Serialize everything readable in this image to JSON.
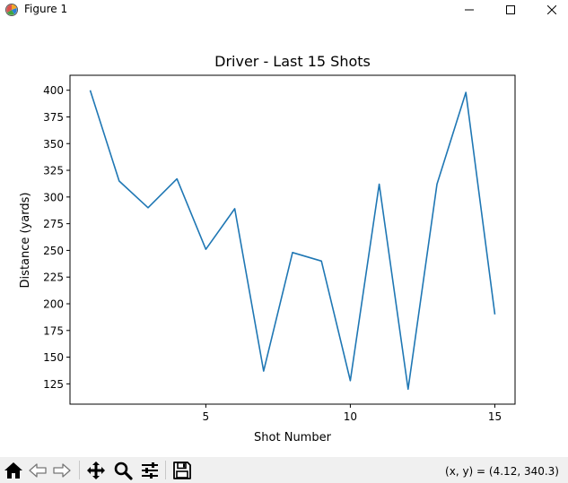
{
  "window": {
    "title": "Figure 1",
    "app_icon": "matplotlib-icon",
    "controls": {
      "minimize_icon": "minimize-icon",
      "maximize_icon": "maximize-icon",
      "close_icon": "close-icon"
    }
  },
  "toolbar": {
    "tools": [
      {
        "name": "home",
        "icon": "home-icon"
      },
      {
        "name": "back",
        "icon": "back-arrow-icon"
      },
      {
        "name": "forward",
        "icon": "forward-arrow-icon"
      },
      {
        "name": "pan",
        "icon": "pan-icon"
      },
      {
        "name": "zoom",
        "icon": "zoom-icon"
      },
      {
        "name": "configure-subplots",
        "icon": "sliders-icon"
      },
      {
        "name": "save",
        "icon": "save-icon"
      }
    ],
    "coords": "(x, y) = (4.12, 340.3)"
  },
  "colors": {
    "line": "#1f77b4",
    "toolbar_bg": "#f0f0f0"
  },
  "chart_data": {
    "type": "line",
    "title": "Driver - Last 15 Shots",
    "xlabel": "Shot Number",
    "ylabel": "Distance (yards)",
    "x": [
      1,
      2,
      3,
      4,
      5,
      6,
      7,
      8,
      9,
      10,
      11,
      12,
      13,
      14,
      15
    ],
    "series": [
      {
        "values": [
          400,
          315,
          290,
          317,
          251,
          289,
          137,
          248,
          240,
          128,
          312,
          120,
          312,
          398,
          190
        ]
      }
    ],
    "xlim": [
      0.3,
      15.7
    ],
    "ylim": [
      106,
      414
    ],
    "xticks": [
      5,
      10,
      15
    ],
    "xtick_labels": [
      "5",
      "10",
      "15"
    ],
    "yticks": [
      125,
      150,
      175,
      200,
      225,
      250,
      275,
      300,
      325,
      350,
      375,
      400
    ],
    "ytick_labels": [
      "125",
      "150",
      "175",
      "200",
      "225",
      "250",
      "275",
      "300",
      "325",
      "350",
      "375",
      "400"
    ],
    "grid": false,
    "legend": "none"
  }
}
